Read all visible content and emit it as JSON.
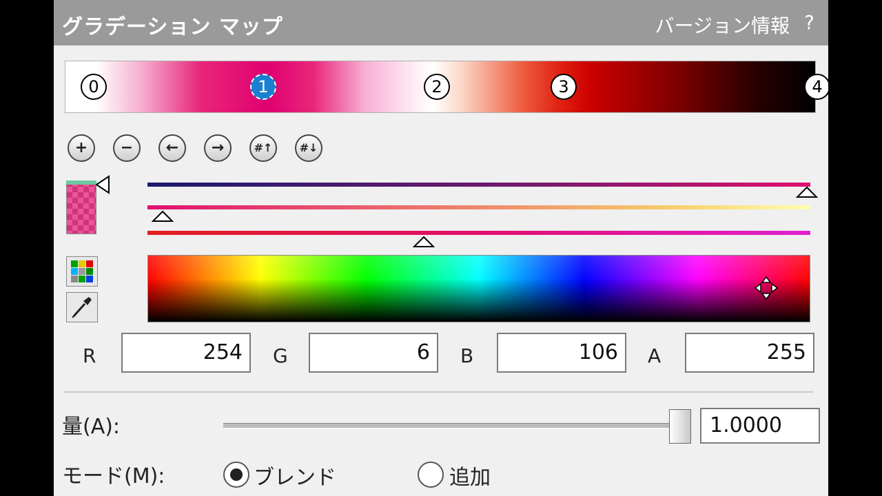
{
  "panel": {
    "title": "グラデーション マップ",
    "version_link": "バージョン情報",
    "help": "?"
  },
  "gradient_stops": [
    "0",
    "1",
    "2",
    "3",
    "4"
  ],
  "selected_stop": "1",
  "stop_tools": {
    "add": "+",
    "remove": "−",
    "move_left": "←",
    "move_right": "→",
    "num_up": "#↑",
    "num_down": "#↓"
  },
  "colors": {
    "selected_color": "#fe066a",
    "selected_stop_fill": "#1a7fd0"
  },
  "channels": [
    {
      "label": "R",
      "value": "254"
    },
    {
      "label": "G",
      "value": "6"
    },
    {
      "label": "B",
      "value": "106"
    },
    {
      "label": "A",
      "value": "255"
    }
  ],
  "amount": {
    "label": "量(A):",
    "value": "1.0000"
  },
  "mode": {
    "label": "モード(M):",
    "options": [
      "ブレンド",
      "追加"
    ],
    "selected": "ブレンド"
  }
}
